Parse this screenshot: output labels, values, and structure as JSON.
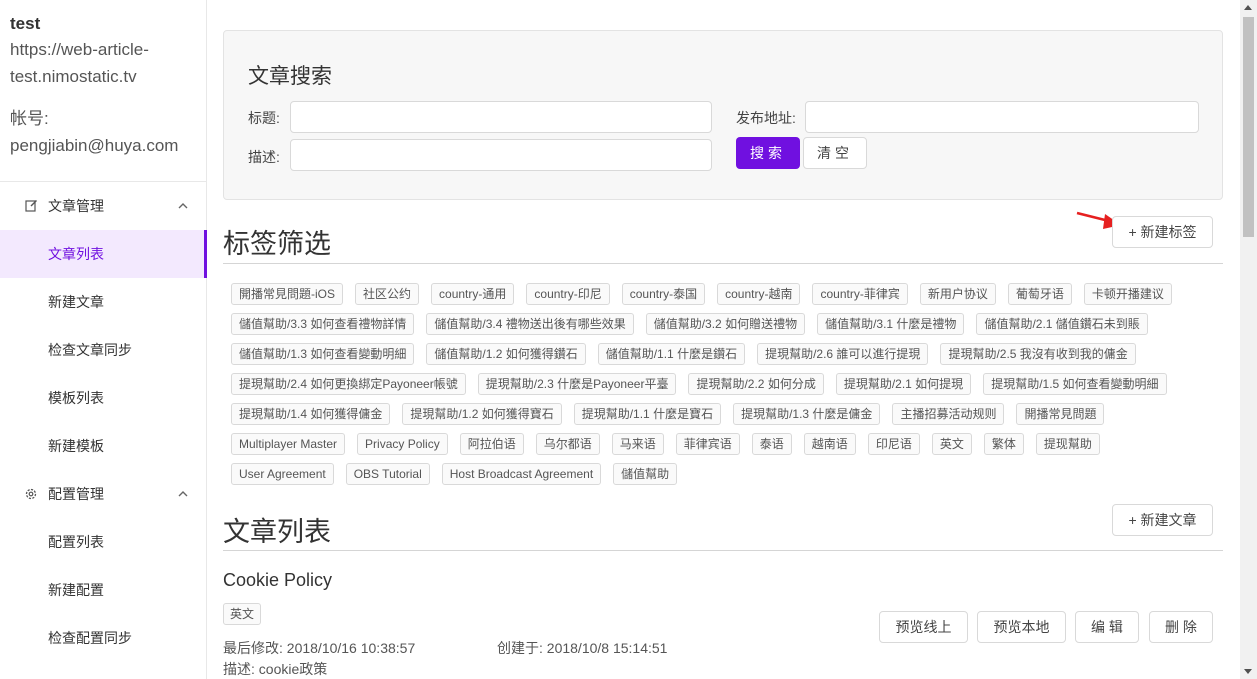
{
  "user": {
    "name": "test",
    "url_line1": "https://web-article-",
    "url_line2": "test.nimostatic.tv",
    "account_label": "帐号:",
    "email": "pengjiabin@huya.com"
  },
  "sidebar": {
    "article_group": "文章管理",
    "article_items": [
      "文章列表",
      "新建文章",
      "检查文章同步",
      "模板列表",
      "新建模板"
    ],
    "config_group": "配置管理",
    "config_items": [
      "配置列表",
      "新建配置",
      "检查配置同步"
    ]
  },
  "search": {
    "title": "文章搜索",
    "title_label": "标题:",
    "desc_label": "描述:",
    "address_label": "发布地址:",
    "title_value": "",
    "desc_value": "",
    "address_value": "",
    "search_button": "搜索",
    "clear_button": "清空"
  },
  "tag_filter": {
    "title": "标签筛选",
    "new_tag_button": "+ 新建标签",
    "tags": [
      "開播常見問題-iOS",
      "社区公约",
      "country-通用",
      "country-印尼",
      "country-泰国",
      "country-越南",
      "country-菲律宾",
      "新用户协议",
      "葡萄牙语",
      "卡顿开播建议",
      "儲值幫助/3.3 如何查看禮物詳情",
      "儲值幫助/3.4 禮物送出後有哪些效果",
      "儲值幫助/3.2 如何贈送禮物",
      "儲值幫助/3.1 什麼是禮物",
      "儲值幫助/2.1 儲值鑽石未到賬",
      "儲值幫助/1.3 如何查看變動明細",
      "儲值幫助/1.2 如何獲得鑽石",
      "儲值幫助/1.1 什麼是鑽石",
      "提現幫助/2.6 誰可以進行提現",
      "提現幫助/2.5 我沒有收到我的傭金",
      "提現幫助/2.4 如何更換綁定Payoneer帳號",
      "提現幫助/2.3 什麼是Payoneer平臺",
      "提現幫助/2.2 如何分成",
      "提現幫助/2.1 如何提現",
      "提現幫助/1.5 如何查看變動明細",
      "提現幫助/1.4 如何獲得傭金",
      "提現幫助/1.2 如何獲得寶石",
      "提現幫助/1.1 什麼是寶石",
      "提現幫助/1.3 什麼是傭金",
      "主播招募活动规则",
      "開播常見問題",
      "Multiplayer Master",
      "Privacy Policy",
      "阿拉伯语",
      "乌尔都语",
      "马来语",
      "菲律宾语",
      "泰语",
      "越南语",
      "印尼语",
      "英文",
      "繁体",
      "提现幫助",
      "User Agreement",
      "OBS Tutorial",
      "Host Broadcast Agreement",
      "儲值幫助"
    ]
  },
  "article_list": {
    "title": "文章列表",
    "new_article_button": "+ 新建文章",
    "article": {
      "title": "Cookie Policy",
      "tag": "英文",
      "modified": "最后修改:  2018/10/16 10:38:57",
      "created": "创建于:  2018/10/8 15:14:51",
      "description": "描述:  cookie政策",
      "preview_online": "预览线上",
      "preview_local": "预览本地",
      "edit": "编 辑",
      "delete": "删 除"
    }
  },
  "colors": {
    "primary": "#7010e0",
    "active_bg": "#f3e9fe",
    "annotation_arrow": "#e62020"
  }
}
